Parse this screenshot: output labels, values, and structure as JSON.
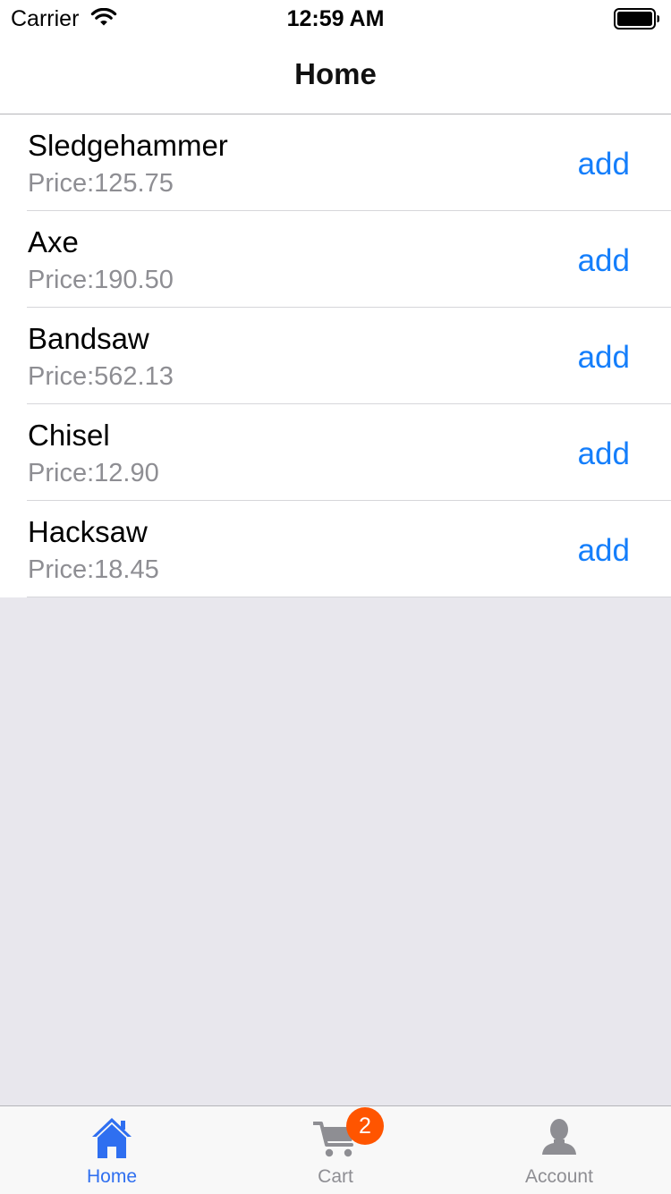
{
  "status_bar": {
    "carrier": "Carrier",
    "time": "12:59 AM"
  },
  "nav": {
    "title": "Home"
  },
  "products": [
    {
      "name": "Sledgehammer",
      "price": "Price:125.75",
      "action": "add"
    },
    {
      "name": "Axe",
      "price": "Price:190.50",
      "action": "add"
    },
    {
      "name": "Bandsaw",
      "price": "Price:562.13",
      "action": "add"
    },
    {
      "name": "Chisel",
      "price": "Price:12.90",
      "action": "add"
    },
    {
      "name": "Hacksaw",
      "price": "Price:18.45",
      "action": "add"
    }
  ],
  "tabs": [
    {
      "label": "Home",
      "icon": "home-icon",
      "selected": true
    },
    {
      "label": "Cart",
      "icon": "cart-icon",
      "badge": "2"
    },
    {
      "label": "Account",
      "icon": "person-icon"
    }
  ],
  "colors": {
    "accent": "#147efb",
    "tab_selected": "#2f6ff0",
    "badge": "#ff5500",
    "background": "#e8e7ed"
  }
}
